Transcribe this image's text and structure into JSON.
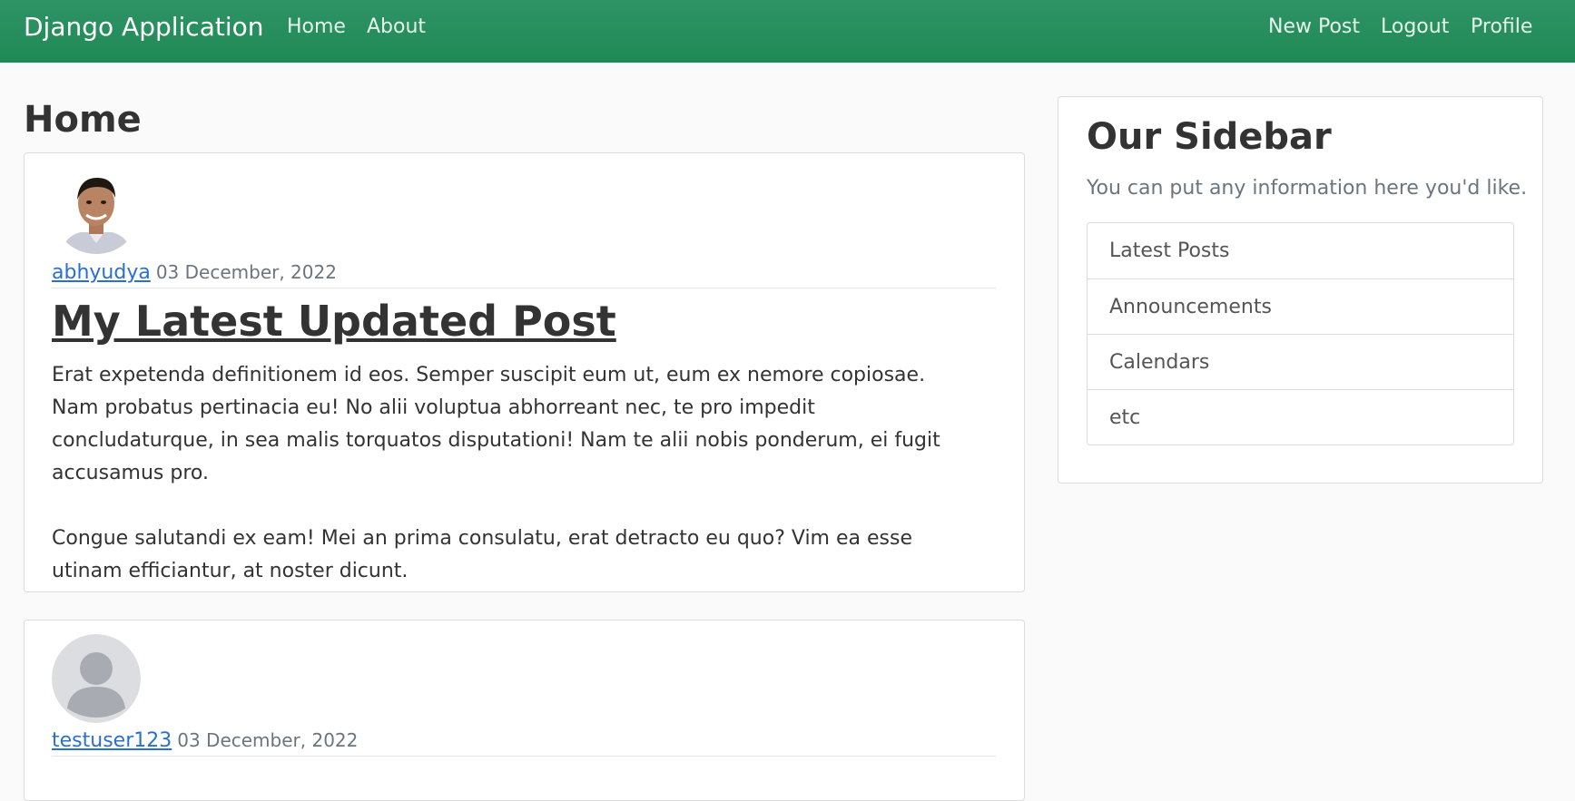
{
  "navbar": {
    "brand": "Django Application",
    "left_links": [
      "Home",
      "About"
    ],
    "right_links": [
      "New Post",
      "Logout",
      "Profile"
    ]
  },
  "main": {
    "title": "Home"
  },
  "posts": [
    {
      "author": "abhyudya",
      "date": "03 December, 2022",
      "avatar_icon": "user-photo-icon",
      "title": "My Latest Updated Post",
      "paragraphs": [
        "Erat expetenda definitionem id eos. Semper suscipit eum ut, eum ex nemore copiosae. Nam probatus pertinacia eu! No alii voluptua abhorreant nec, te pro impedit concludaturque, in sea malis torquatos disputationi! Nam te alii nobis ponderum, ei fugit accusamus pro.",
        "Congue salutandi ex eam! Mei an prima consulatu, erat detracto eu quo? Vim ea esse utinam efficiantur, at noster dicunt."
      ]
    },
    {
      "author": "testuser123",
      "date": "03 December, 2022",
      "avatar_icon": "default-user-avatar-icon"
    }
  ],
  "sidebar": {
    "title": "Our Sidebar",
    "text": "You can put any information here you'd like.",
    "items": [
      "Latest Posts",
      "Announcements",
      "Calendars",
      "etc"
    ]
  },
  "colors": {
    "navbar": "#2a8f5f",
    "link": "#2a6fd6",
    "background": "#fafafa"
  }
}
